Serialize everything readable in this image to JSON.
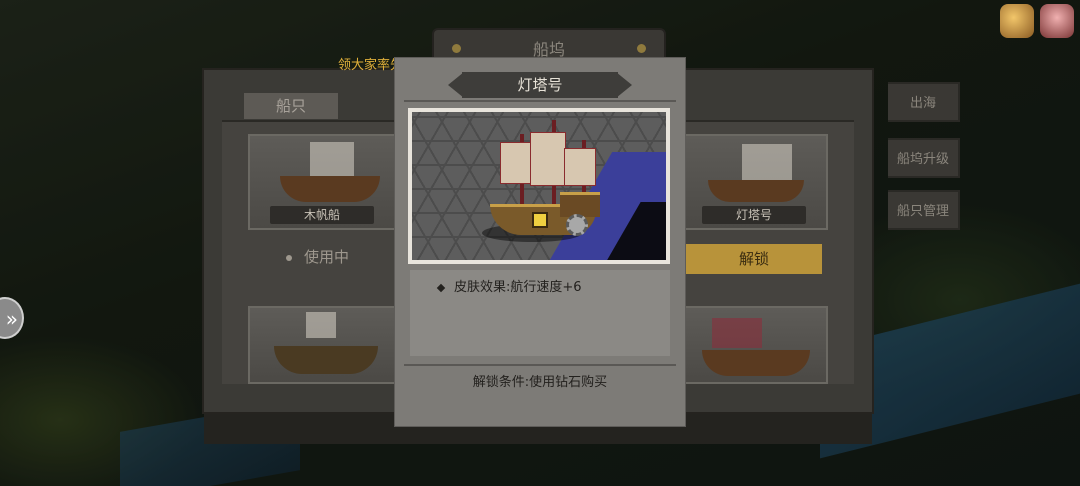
{
  "dock": {
    "title": "船坞",
    "section_label": "船只",
    "side_tabs": [
      "出海",
      "船坞升级",
      "船只管理"
    ]
  },
  "ticker": "领大家率先击败了[寄生体]",
  "ships": [
    {
      "name": "木帆船",
      "status": "使用中"
    },
    {
      "name": "灯塔号",
      "action": "解锁"
    }
  ],
  "popup": {
    "title": "灯塔号",
    "effect": "皮肤效果:航行速度+6",
    "unlock_condition": "解锁条件:使用钻石购买"
  },
  "icons": {
    "nav": "chevron-right-icon",
    "hud_1": "treasure-chest-icon",
    "hud_2": "mailbox-icon"
  },
  "colors": {
    "unlock_button": "#b8933a",
    "ticker_text": "#e0b03a"
  }
}
